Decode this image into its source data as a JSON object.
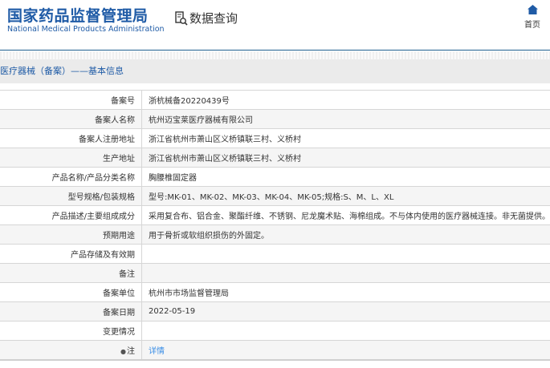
{
  "header": {
    "logo_cn": "国家药品监督管理局",
    "logo_en": "National Medical Products Administration",
    "query_label": "数据查询",
    "home_label": "首页"
  },
  "section_title": "医疗器械（备案）——基本信息",
  "rows": [
    {
      "label": "备案号",
      "value": "浙杭械备20220439号"
    },
    {
      "label": "备案人名称",
      "value": "杭州迈宝莱医疗器械有限公司"
    },
    {
      "label": "备案人注册地址",
      "value": "浙江省杭州市萧山区义桥镇联三村、义桥村"
    },
    {
      "label": "生产地址",
      "value": "浙江省杭州市萧山区义桥镇联三村、义桥村"
    },
    {
      "label": "产品名称/产品分类名称",
      "value": "胸腰椎固定器"
    },
    {
      "label": "型号规格/包装规格",
      "value": "型号:MK-01、MK-02、MK-03、MK-04、MK-05;规格:S、M、L、XL"
    },
    {
      "label": "产品描述/主要组成成分",
      "value": "采用复合布、铝合金、聚酯纤维、不锈钢、尼龙魔术贴、海棉组成。不与体内使用的医疗器械连接。非无菌提供。"
    },
    {
      "label": "预期用途",
      "value": "用于骨折或软组织损伤的外固定。"
    },
    {
      "label": "产品存储及有效期",
      "value": ""
    },
    {
      "label": "备注",
      "value": ""
    },
    {
      "label": "备案单位",
      "value": "杭州市市场监督管理局"
    },
    {
      "label": "备案日期",
      "value": "2022-05-19"
    },
    {
      "label": "变更情况",
      "value": ""
    },
    {
      "label": "注",
      "value": "详情"
    }
  ]
}
